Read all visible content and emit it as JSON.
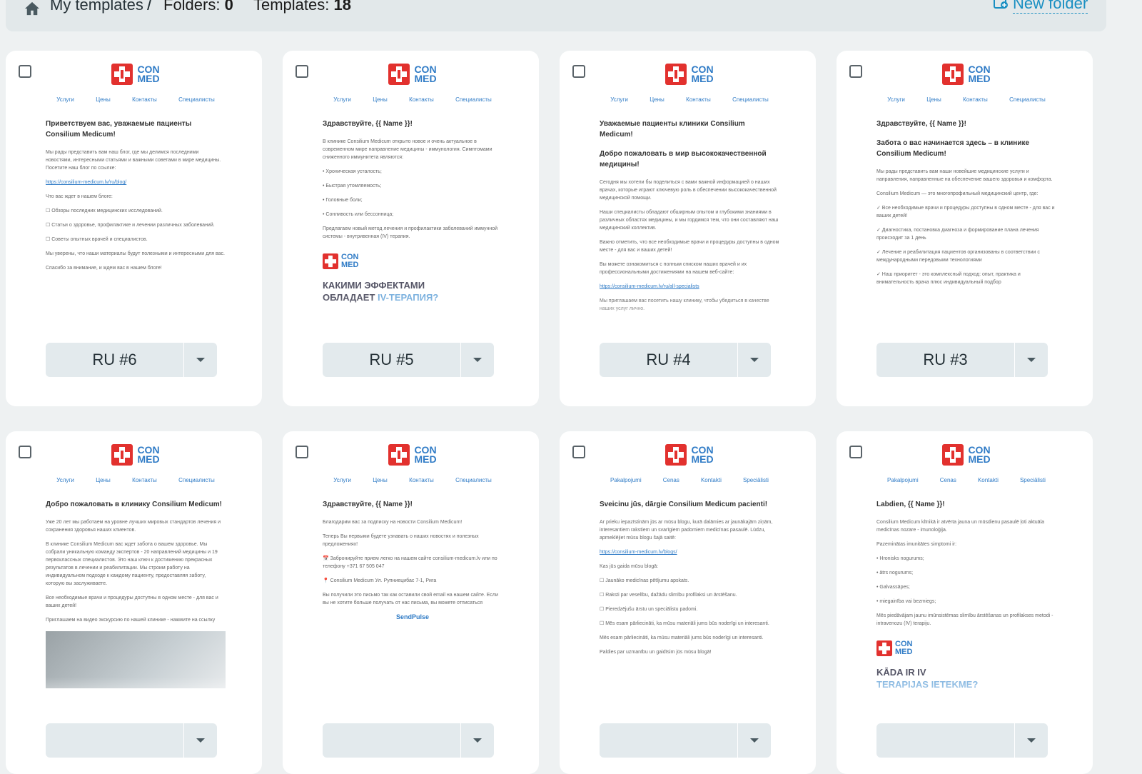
{
  "header": {
    "breadcrumb_link": "My templates",
    "breadcrumb_separator": "/",
    "folders_label": "Folders:",
    "folders_count": "0",
    "templates_label": "Templates:",
    "templates_count": "18",
    "new_folder_label": "New folder"
  },
  "colors": {
    "accent": "#1a8fc2",
    "brand_red": "#e2312e",
    "brand_blue": "#2f7bc6",
    "card_button": "#e3eaed"
  },
  "brand": {
    "line1": "CON",
    "line2": "MED"
  },
  "cards": [
    {
      "name": "RU #6",
      "nav": [
        "Услуги",
        "Цены",
        "Контакты",
        "Специалисты"
      ],
      "title": "Приветствуем вас, уважаемые пациенты Consilium Medicum!",
      "lines": [
        "Мы рады представить вам наш блог, где мы делимся последними новостями, интересными статьями и важными советами в мире медицины. Посетите наш блог по ссылке:",
        "https://consilium-medicum.lv/ru/blog/",
        "Что вас ждет в нашем блоге:",
        "☐ Обзоры последних медицинских исследований.",
        "☐ Статьи о здоровье, профилактике и лечении различных заболеваний.",
        "☐ Советы опытных врачей и специалистов.",
        "Мы уверены, что наши материалы будут полезными и интересными для вас.",
        "Спасибо за внимание, и ждем вас в нашем блоге!"
      ]
    },
    {
      "name": "RU #5",
      "nav": [
        "Услуги",
        "Цены",
        "Контакты",
        "Специалисты"
      ],
      "title": "Здравствуйте, {{ Name }}!",
      "lines": [
        "В клинике Consilium Medicum открыто новое и очень актуальное в современном мире направление медицины - иммунология. Симптомами сниженного иммунитета являются:",
        "• Хроническая усталость;",
        "• Быстрая утомляемость;",
        "• Головные боли;",
        "• Сонливость или бессонница;",
        "Предлагаем новый метод лечения и профилактики заболеваний иммунной системы - внутривенная (IV) терапия."
      ],
      "banner_title": "КАКИМИ ЭФФЕКТАМИ",
      "banner_title2": "ОБЛАДАЕТ",
      "banner_accent": "IV-ТЕРАПИЯ?"
    },
    {
      "name": "RU #4",
      "nav": [
        "Услуги",
        "Цены",
        "Контакты",
        "Специалисты"
      ],
      "title": "Уважаемые пациенты клиники Consilium Medicum!",
      "subtitle": "Добро пожаловать в мир высококачественной медицины!",
      "lines": [
        "Сегодня мы хотели бы поделиться с вами важной информацией о наших врачах, которые играют ключевую роль в обеспечении высококачественной медицинской помощи.",
        "Наши специалисты обладают обширным опытом и глубокими знаниями в различных областях медицины, и мы гордимся тем, что они составляют наш медицинский коллектив.",
        "Важно отметить, что все необходимые врачи и процедуры доступны в одном месте - для вас и ваших детей!",
        "Вы можете ознакомиться с полным списком наших врачей и их профессиональными достижениями на нашем веб-сайте:",
        "https://consilium-medicum.lv/ru/all-specialists",
        "Мы приглашаем вас посетить нашу клинику, чтобы убедиться в качестве наших услуг лично."
      ]
    },
    {
      "name": "RU #3",
      "nav": [
        "Услуги",
        "Цены",
        "Контакты",
        "Специалисты"
      ],
      "title": "Здравствуйте, {{ Name }}!",
      "subtitle": "Забота о вас начинается здесь – в клинике Consilium Medicum!",
      "lines": [
        "Мы рады представить вам наши новейшие медицинские услуги и направления, направленные на обеспечение вашего здоровья и комфорта.",
        "Consilium Medicum — это многопрофильный медицинский центр, где:",
        "✓ Все необходимые врачи и процедуры доступны в одном месте - для вас и ваших детей!",
        "✓ Диагностика, постановка диагноза и формирование плана лечения происходит за 1 день",
        "✓ Лечение и реабилитация пациентов организованы в соответствии с международными передовыми технологиями",
        "✓ Наш приоритет - это комплексный подход: опыт, практика и внимательность врача плюс индивидуальный подбор"
      ]
    },
    {
      "name": "",
      "nav": [
        "Услуги",
        "Цены",
        "Контакты",
        "Специалисты"
      ],
      "title": "Добро пожаловать в клинику Consilium Medicum!",
      "lines": [
        "Уже 20 лет мы работаем на уровне лучших мировых стандартов лечения и сохранения здоровья наших клиентов.",
        "В клинике Consilium Medicum вас ждет забота о вашем здоровье. Мы собрали уникальную команду экспертов - 20 направлений медицины и 19 первоклассных специалистов. Это наш ключ к достижению прекрасных результатов в лечении и реабилитации. Мы строим работу на индивидуальном подходе к каждому пациенту, предоставляя заботу, которую вы заслуживаете.",
        "Все необходимые врачи и процедуры доступны в одном месте - для вас и ваших детей!",
        "Приглашаем на видео экскурсию по нашей клинике - нажмите на ссылку"
      ]
    },
    {
      "name": "",
      "nav": [
        "Услуги",
        "Цены",
        "Контакты",
        "Специалисты"
      ],
      "title": "Здравствуйте, {{ Name }}!",
      "lines": [
        "Благодарим вас за подписку на новости Consilium Medicum!",
        "Теперь Вы первыми будете узнавать о наших новостях и полезных предложениях!",
        "📅 Забронируйте прием легко на нашем сайте consilium-medicum.lv или по телефону +371 67 505 047",
        "📍 Consilium Medicum Ул. Рупниецибас 7-1, Рига",
        "Вы получили это письмо так как оставили свой email на нашем сайте. Если вы не хотите больше получать от нас письма, вы можете отписаться"
      ],
      "footer_brand": "SendPulse"
    },
    {
      "name": "",
      "nav": [
        "Pakalpojumi",
        "Cenas",
        "Kontakti",
        "Speciālisti"
      ],
      "title": "Sveicinu jūs, dārgie Consilium Medicum pacienti!",
      "lines": [
        "Ar prieku iepazīstinām jūs ar mūsu blogu, kurā dalāmies ar jaunākajām ziņām, interesantiem rakstiem un svarīgiem padomiem medicīnas pasaulē. Lūdzu, apmeklējiet mūsu blogu šajā saitē:",
        "https://consilium-medicum.lv/blogs/",
        "Kas jūs gaida mūsu blogā:",
        "☐ Jaunāko medicīnas pētījumu apskats.",
        "☐ Raksti par veselību, dažādu slimību profilaksi un ārstēšanu.",
        "☐ Pieredzējušu ārstu un speciālistu padomi.",
        "☐ Mēs esam pārliecināti, ka mūsu materiāli jums būs noderīgi un interesanti.",
        "Mēs esam pārliecināti, ka mūsu materiāli jums būs noderīgi un interesanti.",
        "Paldies par uzmanību un gaidīsim jūs mūsu blogā!"
      ]
    },
    {
      "name": "",
      "nav": [
        "Pakalpojumi",
        "Cenas",
        "Kontakti",
        "Speciālisti"
      ],
      "title": "Labdien, {{ Name }}!",
      "lines": [
        "Consilium Medicum klīnikā ir atvērta jauna un mūsdienu pasaulē ļoti aktuāla medicīnas nozare - imunoloģija.",
        "Pazeminātas imunitātes simptomi ir:",
        "• Hronisks nogurums;",
        "• ātrs nogurums;",
        "• Galvassāpes;",
        "• miegainība vai bezmiegs;",
        "Mēs piedāvājam jaunu imūnsistēmas slimību ārstēšanas un profilakses metodi - intravenozu (IV) terapiju."
      ],
      "banner_title": "KĀDA IR IV",
      "banner_title2": "",
      "banner_accent": "TERAPIJAS IETEKME?"
    }
  ]
}
